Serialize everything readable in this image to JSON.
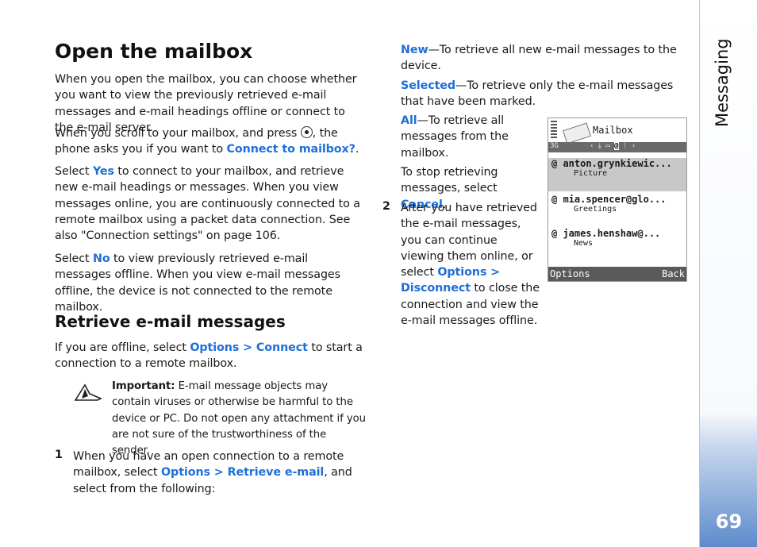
{
  "title": "Open the mailbox",
  "left": {
    "p1": "When you open the mailbox, you can choose whether you want to view the previously retrieved e-mail messages and e-mail headings offline or connect to the e-mail server.",
    "p2a": "When you scroll to your mailbox, and press",
    "p2b": ", the phone asks you if you want to",
    "p2link": "Connect to mailbox?",
    "p3link": "Yes",
    "p3": "to connect to your mailbox, and retrieve new e-mail headings or messages. When you view messages online, you are continuously connected to a remote mailbox using a packet data connection. See also \"Connection settings\" on page 106.",
    "p4link": "No",
    "p4": "to view previously retrieved e-mail messages offline. When you view e-mail messages offline, the device is not connected to the remote mailbox.",
    "select": "Select",
    "h2": "Retrieve e-mail messages",
    "p5a": "If you are offline, select",
    "p5link": "Options > Connect",
    "p5b": "to start a connection to a remote mailbox.",
    "important_label": "Important:",
    "important": "E-mail message objects may contain viruses or otherwise be harmful to the device or PC. Do not open any attachment if you are not sure of the trustworthiness of the sender.",
    "step1_num": "1",
    "step1a": "When you have an open connection to a remote mailbox, select",
    "step1link": "Options > Retrieve e-mail",
    "step1b": ", and select from the following:"
  },
  "right": {
    "new_link": "New",
    "new": "—To retrieve all new e-mail messages to the device.",
    "sel_link": "Selected",
    "sel": "—To retrieve only the e-mail messages that have been marked.",
    "all_link": "All",
    "all": "—To retrieve all messages from the mailbox.",
    "stop": "To stop retrieving messages, select",
    "cancel": "Cancel",
    "step2_num": "2",
    "step2a": "After you have retrieved the e-mail messages, you can continue viewing them online, or select",
    "step2link": "Options > Disconnect",
    "step2b": "to close the connection and view the e-mail messages offline."
  },
  "phone": {
    "title": "Mailbox",
    "network": "3G",
    "items": [
      {
        "from": "anton.grynkiewic...",
        "subject": "Picture"
      },
      {
        "from": "mia.spencer@glo...",
        "subject": "Greetings"
      },
      {
        "from": "james.henshaw@...",
        "subject": "News"
      }
    ],
    "left_soft": "Options",
    "right_soft": "Back"
  },
  "sidebar": {
    "section": "Messaging",
    "page": "69",
    "accent": "#5e8bcb"
  },
  "link_color": "#1e6fd9"
}
